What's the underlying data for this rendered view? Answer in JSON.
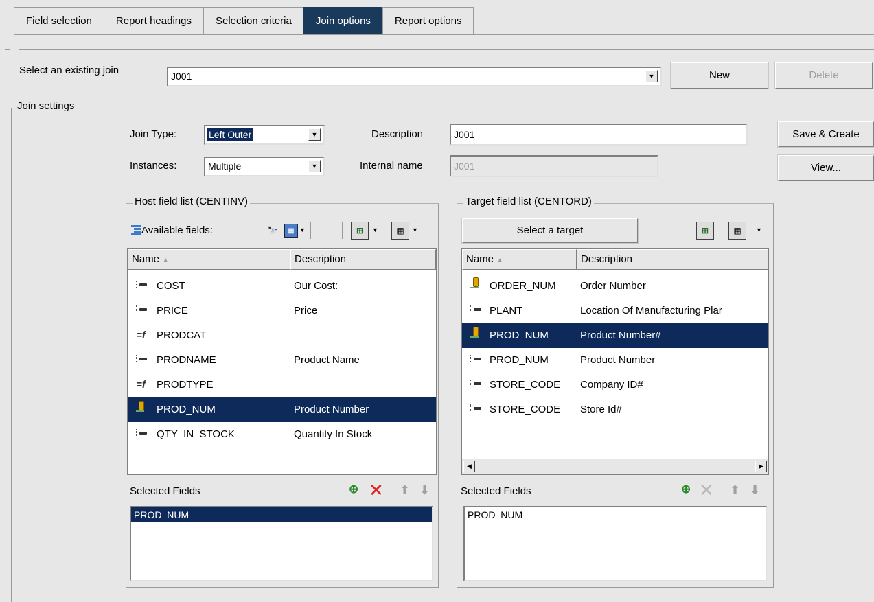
{
  "tabs": [
    {
      "label": "Field selection"
    },
    {
      "label": "Report headings"
    },
    {
      "label": "Selection criteria"
    },
    {
      "label": "Join options"
    },
    {
      "label": "Report options"
    }
  ],
  "existing_join": {
    "label": "Select an existing join",
    "value": "J001",
    "new_label": "New",
    "delete_label": "Delete"
  },
  "join_settings": {
    "legend": "Join settings",
    "join_type_label": "Join Type:",
    "join_type_value": "Left Outer",
    "instances_label": "Instances:",
    "instances_value": "Multiple",
    "description_label": "Description",
    "description_value": "J001",
    "internal_name_label": "Internal name",
    "internal_name_value": "J001",
    "save_create_label": "Save & Create",
    "view_label": "View..."
  },
  "host": {
    "legend": "Host field list (CENTINV)",
    "available_label": "Available fields:",
    "col_name": "Name",
    "col_desc": "Description",
    "rows": [
      {
        "name": "COST",
        "desc": "Our Cost:",
        "icon": "field-icon"
      },
      {
        "name": "PRICE",
        "desc": "Price",
        "icon": "field-icon"
      },
      {
        "name": "PRODCAT",
        "desc": "",
        "icon": "function-icon"
      },
      {
        "name": "PRODNAME",
        "desc": "Product Name",
        "icon": "field-icon"
      },
      {
        "name": "PRODTYPE",
        "desc": "",
        "icon": "function-icon"
      },
      {
        "name": "PROD_NUM",
        "desc": "Product Number",
        "icon": "key-icon"
      },
      {
        "name": "QTY_IN_STOCK",
        "desc": "Quantity In Stock",
        "icon": "field-icon"
      }
    ],
    "selected_label": "Selected Fields",
    "selected": [
      "PROD_NUM"
    ]
  },
  "target": {
    "legend": "Target field list (CENTORD)",
    "select_target_label": "Select a target",
    "col_name": "Name",
    "col_desc": "Description",
    "rows": [
      {
        "name": "ORDER_NUM",
        "desc": "Order Number",
        "icon": "key-icon"
      },
      {
        "name": "PLANT",
        "desc": "Location Of Manufacturing Plar",
        "icon": "field-icon"
      },
      {
        "name": "PROD_NUM",
        "desc": "Product Number#",
        "icon": "key-icon"
      },
      {
        "name": "PROD_NUM",
        "desc": "Product Number",
        "icon": "field-icon"
      },
      {
        "name": "STORE_CODE",
        "desc": "Company ID#",
        "icon": "field-icon"
      },
      {
        "name": "STORE_CODE",
        "desc": "Store Id#",
        "icon": "field-icon"
      }
    ],
    "selected_label": "Selected Fields",
    "selected": [
      "PROD_NUM"
    ]
  },
  "colors": {
    "selection": "#0d2a5a",
    "active_tab": "#1a3a5c",
    "delete_red": "#e02020"
  }
}
